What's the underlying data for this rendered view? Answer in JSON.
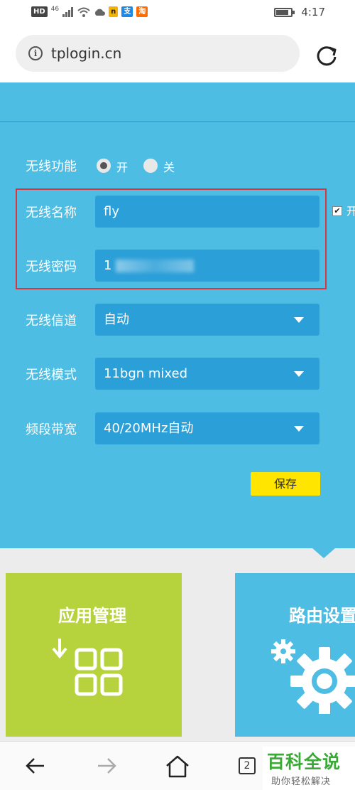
{
  "status_bar": {
    "left_chips": [
      "HD",
      "46",
      "n",
      "支",
      "淘"
    ],
    "time": "4:17",
    "battery_level": 0.85
  },
  "address_bar": {
    "url": "tplogin.cn"
  },
  "wireless": {
    "rows": [
      {
        "label": "无线功能"
      },
      {
        "label": "无线名称",
        "value": "fly"
      },
      {
        "label": "无线密码",
        "value": "1"
      },
      {
        "label": "无线信道",
        "value": "自动"
      },
      {
        "label": "无线模式",
        "value": "11bgn mixed"
      },
      {
        "label": "频段带宽",
        "value": "40/20MHz自动"
      }
    ],
    "radio_on_label": "开",
    "radio_off_label": "关",
    "radio_selected": "开",
    "side_checkbox_label": "开",
    "save_label": "保存"
  },
  "tiles": [
    {
      "title": "应用管理",
      "color": "#b6d23c"
    },
    {
      "title": "路由设置",
      "color": "#4ebde3"
    }
  ],
  "bottom_nav": {
    "tab_count": "2"
  },
  "watermark": {
    "big": "百科全说",
    "small": "助你轻松解决"
  },
  "colors": {
    "panel": "#4ebde3",
    "field": "#2b9fd8",
    "save": "#ffe500",
    "highlight_box": "#d9363e"
  }
}
